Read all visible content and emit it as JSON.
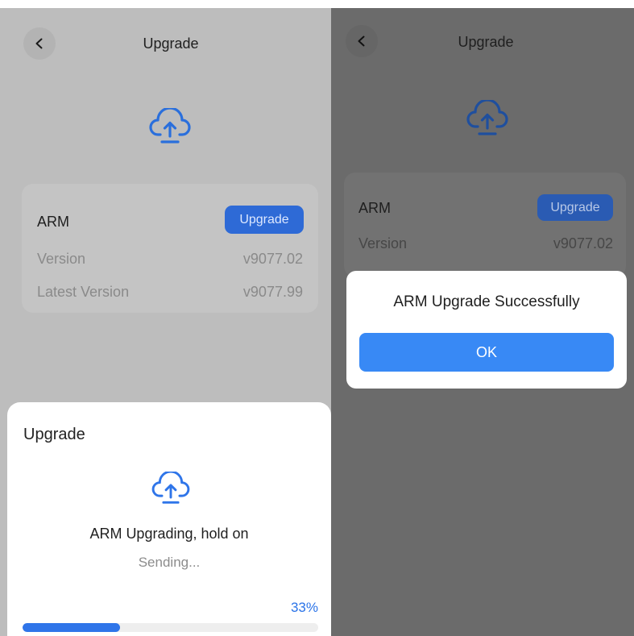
{
  "colors": {
    "accent": "#2F75E9",
    "ok_button": "#3889F5",
    "left_overlay": "#BDBDBD",
    "right_overlay": "#6B6B6B"
  },
  "left": {
    "header": {
      "title": "Upgrade",
      "back_icon": "chevron-left-icon"
    },
    "hero_icon": "cloud-upload-icon",
    "card": {
      "name": "ARM",
      "upgrade_button": "Upgrade",
      "rows": [
        {
          "label": "Version",
          "value": "v9077.02"
        },
        {
          "label": "Latest Version",
          "value": "v9077.99"
        }
      ]
    },
    "sheet": {
      "title": "Upgrade",
      "icon": "cloud-upload-icon",
      "message": "ARM Upgrading, hold on",
      "status": "Sending...",
      "progress_label": "33%",
      "progress_value": 0.33
    }
  },
  "right": {
    "header": {
      "title": "Upgrade",
      "back_icon": "chevron-left-icon"
    },
    "hero_icon": "cloud-upload-icon",
    "card": {
      "name": "ARM",
      "upgrade_button": "Upgrade",
      "rows": [
        {
          "label": "Version",
          "value": "v9077.02"
        }
      ]
    },
    "dialog": {
      "message": "ARM Upgrade Successfully",
      "ok_button": "OK"
    }
  }
}
